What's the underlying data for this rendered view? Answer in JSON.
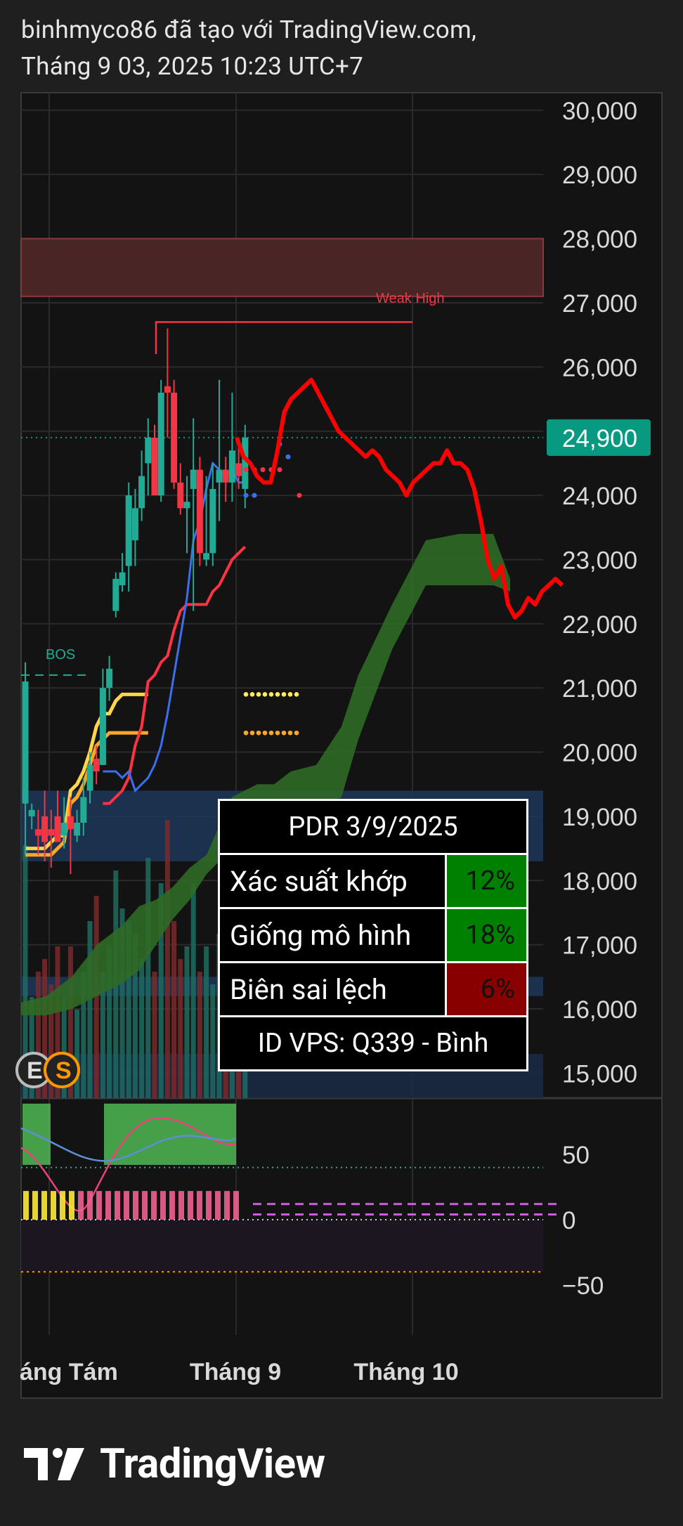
{
  "header": {
    "line1": "binhmyco86 đã tạo với TradingView.com,",
    "line2": "Tháng 9 03, 2025 10:23 UTC+7"
  },
  "brand": {
    "name": "TradingView"
  },
  "colors": {
    "background": "#1f1f1f",
    "plot_background": "#131313",
    "bull": "#22ab94",
    "bear": "#f23645",
    "forecast": "#ff0000",
    "price_label": "#089981",
    "table_good": "#008000",
    "table_bad": "#880000"
  },
  "chart_data": {
    "type": "candlestick",
    "symbol": "PDR",
    "ylim": [
      14750,
      30250
    ],
    "y_ticks": [
      "30,000",
      "29,000",
      "28,000",
      "27,000",
      "26,000",
      "25,000",
      "24,000",
      "23,000",
      "22,000",
      "21,000",
      "20,000",
      "19,000",
      "18,000",
      "17,000",
      "16,000",
      "15,000"
    ],
    "last_price": {
      "value": 24900,
      "label": "24,900"
    },
    "x_ticks": [
      "áng Tám",
      "Tháng 9",
      "Tháng 10"
    ],
    "annotations": [
      "BOS",
      "Weak High"
    ],
    "weak_high": 26700,
    "resistance_zone": [
      27100,
      28000
    ],
    "candles": [
      {
        "o": 19200,
        "h": 21400,
        "l": 18400,
        "c": 21100
      },
      {
        "o": 19000,
        "h": 19200,
        "l": 18800,
        "c": 19100
      },
      {
        "o": 18800,
        "h": 19100,
        "l": 18400,
        "c": 18700
      },
      {
        "o": 19000,
        "h": 19400,
        "l": 18300,
        "c": 18600
      },
      {
        "o": 18800,
        "h": 19100,
        "l": 18200,
        "c": 18700
      },
      {
        "o": 19000,
        "h": 19400,
        "l": 18700,
        "c": 18600
      },
      {
        "o": 18700,
        "h": 19300,
        "l": 18500,
        "c": 18900
      },
      {
        "o": 19000,
        "h": 19300,
        "l": 18100,
        "c": 18800
      },
      {
        "o": 18700,
        "h": 19100,
        "l": 18600,
        "c": 18900
      },
      {
        "o": 18900,
        "h": 19600,
        "l": 18700,
        "c": 19300
      },
      {
        "o": 19400,
        "h": 20000,
        "l": 19200,
        "c": 19800
      },
      {
        "o": 19900,
        "h": 20100,
        "l": 19500,
        "c": 19700
      },
      {
        "o": 19800,
        "h": 21300,
        "l": 19800,
        "c": 21000
      },
      {
        "o": 21000,
        "h": 21500,
        "l": 20800,
        "c": 21300
      },
      {
        "o": 22200,
        "h": 22800,
        "l": 22100,
        "c": 22700
      },
      {
        "o": 22600,
        "h": 23100,
        "l": 22500,
        "c": 22800
      },
      {
        "o": 22900,
        "h": 24200,
        "l": 22500,
        "c": 24000
      },
      {
        "o": 23300,
        "h": 24100,
        "l": 22900,
        "c": 23800
      },
      {
        "o": 23800,
        "h": 24700,
        "l": 23600,
        "c": 24300
      },
      {
        "o": 24500,
        "h": 25200,
        "l": 24000,
        "c": 24900
      },
      {
        "o": 24900,
        "h": 25100,
        "l": 24000,
        "c": 24000
      },
      {
        "o": 24000,
        "h": 25800,
        "l": 23900,
        "c": 25600
      },
      {
        "o": 25700,
        "h": 26600,
        "l": 24900,
        "c": 25600
      },
      {
        "o": 25600,
        "h": 25800,
        "l": 24100,
        "c": 24200
      },
      {
        "o": 24200,
        "h": 24500,
        "l": 23700,
        "c": 23800
      },
      {
        "o": 23800,
        "h": 24300,
        "l": 23100,
        "c": 23900
      },
      {
        "o": 24100,
        "h": 25200,
        "l": 22200,
        "c": 24400
      },
      {
        "o": 24400,
        "h": 24600,
        "l": 22900,
        "c": 23100
      },
      {
        "o": 23000,
        "h": 24300,
        "l": 22900,
        "c": 23100
      },
      {
        "o": 23100,
        "h": 24500,
        "l": 22900,
        "c": 24100
      },
      {
        "o": 24200,
        "h": 25800,
        "l": 23600,
        "c": 24400
      },
      {
        "o": 24400,
        "h": 24600,
        "l": 23900,
        "c": 24200
      },
      {
        "o": 24200,
        "h": 25600,
        "l": 23900,
        "c": 24700
      },
      {
        "o": 24500,
        "h": 24800,
        "l": 24100,
        "c": 24300
      },
      {
        "o": 24100,
        "h": 25100,
        "l": 23800,
        "c": 24900
      }
    ],
    "forecast_path": [
      24900,
      24600,
      24500,
      24300,
      24200,
      24200,
      24700,
      25300,
      25500,
      25600,
      25700,
      25800,
      25600,
      25400,
      25200,
      25000,
      24900,
      24800,
      24700,
      24600,
      24700,
      24600,
      24400,
      24300,
      24200,
      24000,
      24200,
      24300,
      24400,
      24500,
      24500,
      24700,
      24500,
      24500,
      24400,
      24100,
      23600,
      23000,
      22700,
      22900,
      22300,
      22100,
      22200,
      22400,
      22300,
      22500,
      22600,
      22700,
      22600
    ],
    "indicators": {
      "blue_line": [
        19700,
        19700,
        19700,
        19600,
        19700,
        19400,
        19500,
        19600,
        19800,
        20100,
        20600,
        21200,
        21800,
        22400,
        23300,
        23600,
        24100,
        24500,
        24400,
        24300,
        24400,
        24200,
        24200
      ],
      "red_line": [
        19200,
        19200,
        19300,
        19400,
        19600,
        20100,
        20400,
        21100,
        21200,
        21400,
        21500,
        21900,
        22200,
        22300,
        22300,
        22300,
        22300,
        22500,
        22600,
        22800,
        23000,
        23100,
        23200
      ],
      "yellow_line": [
        18500,
        18500,
        18500,
        18500,
        18600,
        18700,
        18700,
        19400,
        19500,
        19700,
        20000,
        20400,
        20600,
        20600,
        20800,
        20900,
        20900,
        20900,
        20900,
        20900
      ],
      "orange_line": [
        18400,
        18400,
        18400,
        18400,
        18400,
        18500,
        18600,
        19200,
        19300,
        19500,
        19800,
        20100,
        20200,
        20300,
        20300,
        20300,
        20300,
        20300,
        20300,
        20300
      ]
    },
    "cloud": {
      "x": [
        0,
        3,
        6,
        9,
        12,
        14,
        16,
        18,
        20,
        22,
        25,
        28,
        30,
        32,
        35,
        38,
        40,
        44,
        48,
        52,
        56,
        58
      ],
      "upper": [
        16100,
        16200,
        16500,
        17000,
        17300,
        17600,
        17700,
        17900,
        18200,
        18400,
        19300,
        19500,
        19500,
        19700,
        19800,
        20400,
        21200,
        22300,
        23300,
        23400,
        23400,
        22700
      ],
      "lower": [
        15900,
        15900,
        16000,
        16200,
        16400,
        16600,
        17000,
        17400,
        17700,
        18100,
        18500,
        18700,
        18900,
        19000,
        19100,
        19300,
        20200,
        21600,
        22600,
        22600,
        22600,
        22500
      ]
    },
    "oscillator": {
      "y_ticks": [
        "50",
        "0",
        "−50"
      ],
      "ylim": [
        -90,
        100
      ],
      "levels": [
        40,
        0,
        -40
      ]
    }
  },
  "table": {
    "title": "PDR 3/9/2025",
    "rows": [
      {
        "label": "Xác suất khớp",
        "value": "12%",
        "color": "#008000"
      },
      {
        "label": "Giống mô hình",
        "value": "18%",
        "color": "#008000"
      },
      {
        "label": "Biên sai lệch",
        "value": "6%",
        "color": "#880000"
      }
    ],
    "footer": "ID VPS: Q339 - Bình"
  },
  "badges": [
    "E",
    "S"
  ]
}
